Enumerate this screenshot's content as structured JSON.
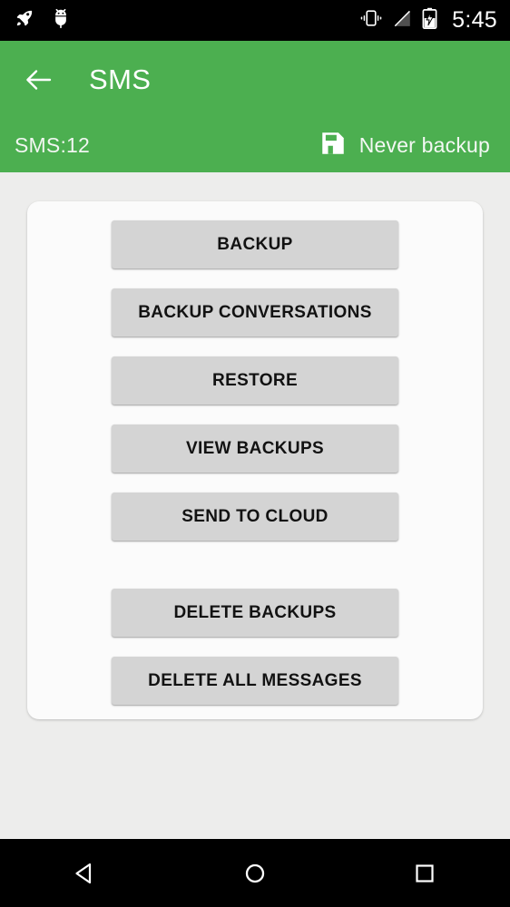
{
  "status_bar": {
    "left_icons": [
      {
        "name": "rocket-icon"
      },
      {
        "name": "android-bug-icon"
      }
    ],
    "right_icons": [
      {
        "name": "vibrate-icon"
      },
      {
        "name": "no-sim-signal-icon"
      },
      {
        "name": "battery-charging-icon"
      }
    ],
    "clock": "5:45"
  },
  "app_bar": {
    "back_icon": "back-arrow-icon",
    "title": "SMS",
    "background_color": "#4caf50"
  },
  "sub_header": {
    "count_label": "SMS:12",
    "backup_icon": "floppy-disk-save-icon",
    "backup_status": "Never backup"
  },
  "actions": {
    "primary": [
      {
        "label": "BACKUP",
        "name": "backup-button"
      },
      {
        "label": "BACKUP CONVERSATIONS",
        "name": "backup-conversations-button"
      },
      {
        "label": "RESTORE",
        "name": "restore-button"
      },
      {
        "label": "VIEW BACKUPS",
        "name": "view-backups-button"
      },
      {
        "label": "SEND TO CLOUD",
        "name": "send-to-cloud-button"
      }
    ],
    "destructive": [
      {
        "label": "DELETE BACKUPS",
        "name": "delete-backups-button"
      },
      {
        "label": "DELETE ALL MESSAGES",
        "name": "delete-all-messages-button"
      }
    ]
  },
  "nav_bar": {
    "back": "nav-back-icon",
    "home": "nav-home-icon",
    "recents": "nav-recents-icon"
  },
  "colors": {
    "accent_green": "#4caf50",
    "page_background": "#ededec",
    "card_background": "#fbfbfb",
    "button_background": "#d4d4d4",
    "button_text": "#121212"
  }
}
